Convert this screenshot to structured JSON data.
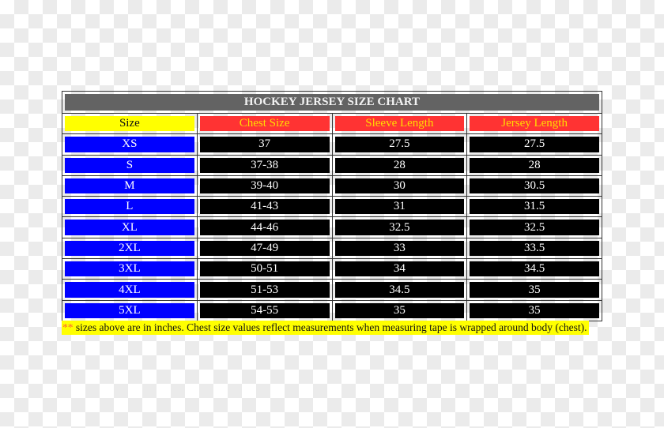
{
  "title": "HOCKEY JERSEY SIZE CHART",
  "headers": [
    "Size",
    "Chest Size",
    "Sleeve Length",
    "Jersey Length"
  ],
  "rows": [
    {
      "size": "XS",
      "chest": "37",
      "sleeve": "27.5",
      "jersey": "27.5"
    },
    {
      "size": "S",
      "chest": "37-38",
      "sleeve": "28",
      "jersey": "28"
    },
    {
      "size": "M",
      "chest": "39-40",
      "sleeve": "30",
      "jersey": "30.5"
    },
    {
      "size": "L",
      "chest": "41-43",
      "sleeve": "31",
      "jersey": "31.5"
    },
    {
      "size": "XL",
      "chest": "44-46",
      "sleeve": "32.5",
      "jersey": "32.5"
    },
    {
      "size": "2XL",
      "chest": "47-49",
      "sleeve": "33",
      "jersey": "33.5"
    },
    {
      "size": "3XL",
      "chest": "50-51",
      "sleeve": "34",
      "jersey": "34.5"
    },
    {
      "size": "4XL",
      "chest": "51-53",
      "sleeve": "34.5",
      "jersey": "35"
    },
    {
      "size": "5XL",
      "chest": "54-55",
      "sleeve": "35",
      "jersey": "35"
    }
  ],
  "note": {
    "marker": "**",
    "text": " sizes above are in inches. Chest size values reflect measurements when measuring tape is wrapped around body (chest)."
  },
  "colors": {
    "title_bg": "#636363",
    "size_header_bg": "#ffff00",
    "header_bg": "#ff3333",
    "header_text": "#ffdd00",
    "size_cell_bg": "#0000ff",
    "value_cell_bg": "#000000",
    "note_bg": "#ffff00",
    "note_marker": "#ff6633"
  }
}
